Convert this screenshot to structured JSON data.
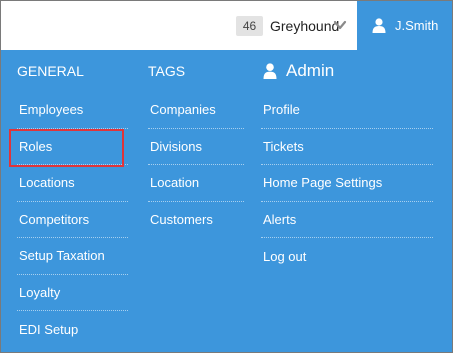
{
  "header": {
    "count": "46",
    "selected_name": "Greyhound",
    "user_name": "J.Smith"
  },
  "general": {
    "heading": "GENERAL",
    "items": [
      "Employees",
      "Roles",
      "Locations",
      "Competitors",
      "Setup Taxation",
      "Loyalty",
      "EDI Setup"
    ]
  },
  "tags": {
    "heading": "TAGS",
    "items": [
      "Companies",
      "Divisions",
      "Location",
      "Customers"
    ]
  },
  "admin": {
    "heading": "Admin",
    "items": [
      "Profile",
      "Tickets",
      "Home Page Settings",
      "Alerts",
      "Log out"
    ]
  },
  "colors": {
    "menu_bg": "#3d96dc",
    "highlight": "#e0343a"
  },
  "icons": [
    "chevron-down-icon",
    "user-icon",
    "admin-user-icon"
  ]
}
